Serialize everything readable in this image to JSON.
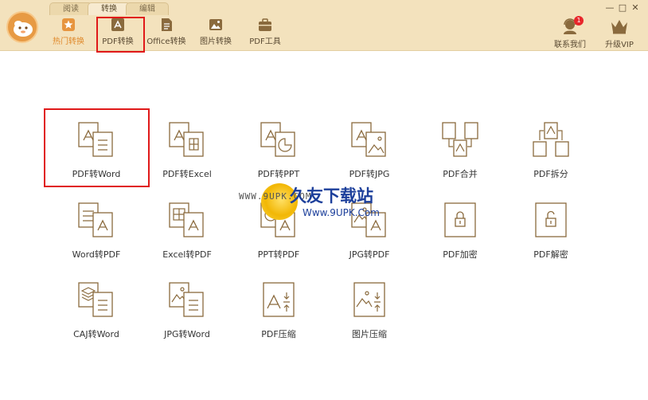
{
  "tabs": [
    {
      "label": "阅读"
    },
    {
      "label": "转换"
    },
    {
      "label": "编辑"
    }
  ],
  "toolbar": {
    "items": [
      {
        "label": "热门转换",
        "icon": "star-icon"
      },
      {
        "label": "PDF转换",
        "icon": "pdf-icon"
      },
      {
        "label": "Office转换",
        "icon": "document-icon"
      },
      {
        "label": "图片转换",
        "icon": "image-icon"
      },
      {
        "label": "PDF工具",
        "icon": "toolbox-icon"
      }
    ],
    "contact_label": "联系我们",
    "contact_badge": "1",
    "vip_label": "升级VIP"
  },
  "window_controls": {
    "minimize": "—",
    "maximize": "□",
    "close": "✕"
  },
  "features": [
    {
      "label": "PDF转Word"
    },
    {
      "label": "PDF转Excel"
    },
    {
      "label": "PDF转PPT"
    },
    {
      "label": "PDF转JPG"
    },
    {
      "label": "PDF合并"
    },
    {
      "label": "PDF拆分"
    },
    {
      "label": "Word转PDF"
    },
    {
      "label": "Excel转PDF"
    },
    {
      "label": "PPT转PDF"
    },
    {
      "label": "JPG转PDF"
    },
    {
      "label": "PDF加密"
    },
    {
      "label": "PDF解密"
    },
    {
      "label": "CAJ转Word"
    },
    {
      "label": "JPG转Word"
    },
    {
      "label": "PDF压缩"
    },
    {
      "label": "图片压缩"
    }
  ],
  "watermark": {
    "url_left": "WWW.9UPK.COM",
    "brand": "久友下载站",
    "url_right": "Www.9UPK.Com"
  },
  "colors": {
    "topbar": "#f3e2bd",
    "accent": "#e08a2c",
    "icon_brown": "#8a6a3d",
    "highlight_red": "#e01919"
  }
}
